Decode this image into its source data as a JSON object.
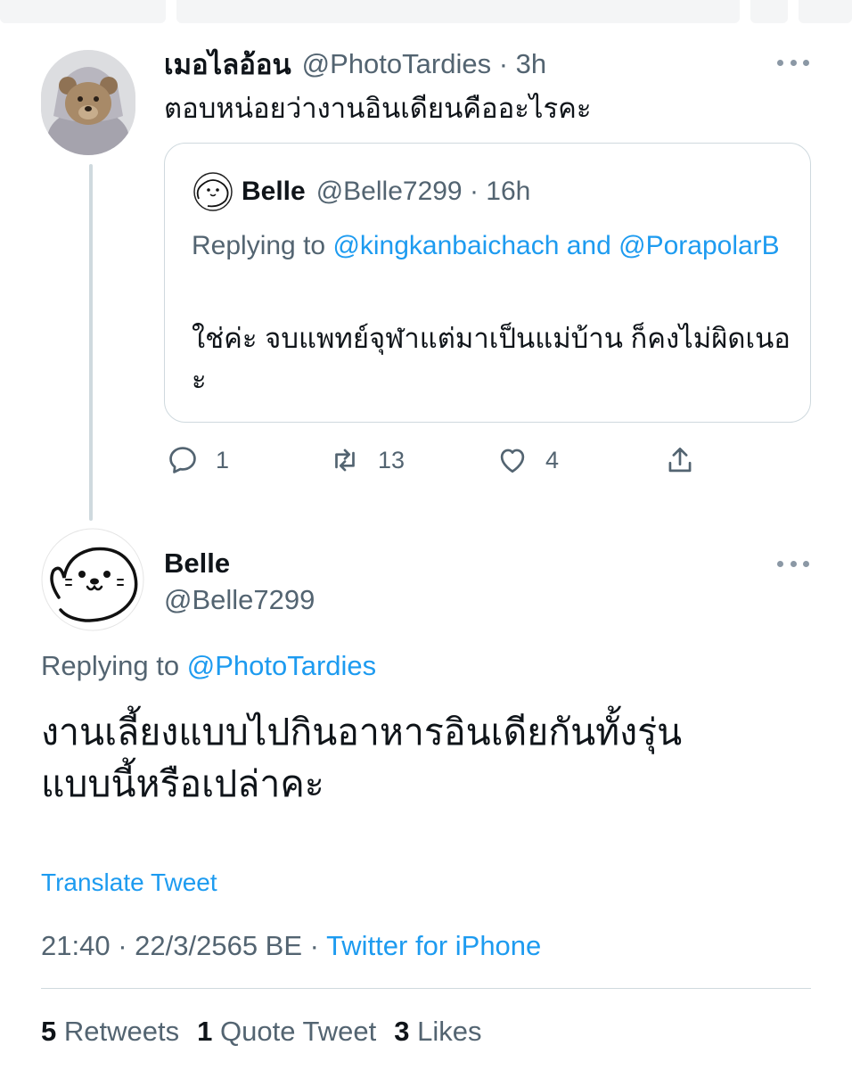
{
  "parent_tweet": {
    "display_name": "เมอไลอ้อน",
    "handle": "@PhotoTardies",
    "time": "3h",
    "text": "ตอบหน่อยว่างานอินเดียนคืออะไรคะ",
    "quoted": {
      "display_name": "Belle",
      "handle": "@Belle7299",
      "time": "16h",
      "replying_prefix": "Replying to",
      "replying_user_1": "@kingkanbaichach",
      "replying_and": "and",
      "replying_user_2": "@PorapolarB",
      "text": "ใช่ค่ะ จบแพทย์จุฬาแต่มาเป็นแม่บ้าน ก็คงไม่ผิดเนอะ"
    },
    "actions": {
      "reply_count": "1",
      "retweet_count": "13",
      "like_count": "4"
    }
  },
  "main_tweet": {
    "display_name": "Belle",
    "handle": "@Belle7299",
    "replying_prefix": "Replying to",
    "replying_user": "@PhotoTardies",
    "text_line1": "งานเลี้ยงแบบไปกินอาหารอินเดียกันทั้งรุ่น",
    "text_line2": "แบบนี้หรือเปล่าคะ",
    "translate_label": "Translate Tweet",
    "time": "21:40",
    "date": "22/3/2565 BE",
    "separator": "·",
    "source": "Twitter for iPhone",
    "stats": {
      "retweets_count": "5",
      "retweets_label": "Retweets",
      "quotes_count": "1",
      "quotes_label": "Quote Tweet",
      "likes_count": "3",
      "likes_label": "Likes"
    }
  },
  "icons": {
    "more": "more-horizontal-icon",
    "reply": "reply-icon",
    "retweet": "retweet-icon",
    "like": "heart-icon",
    "share": "share-icon"
  },
  "colors": {
    "link": "#1d9bf0",
    "secondary_text": "#536471",
    "border": "#cfd9de"
  }
}
